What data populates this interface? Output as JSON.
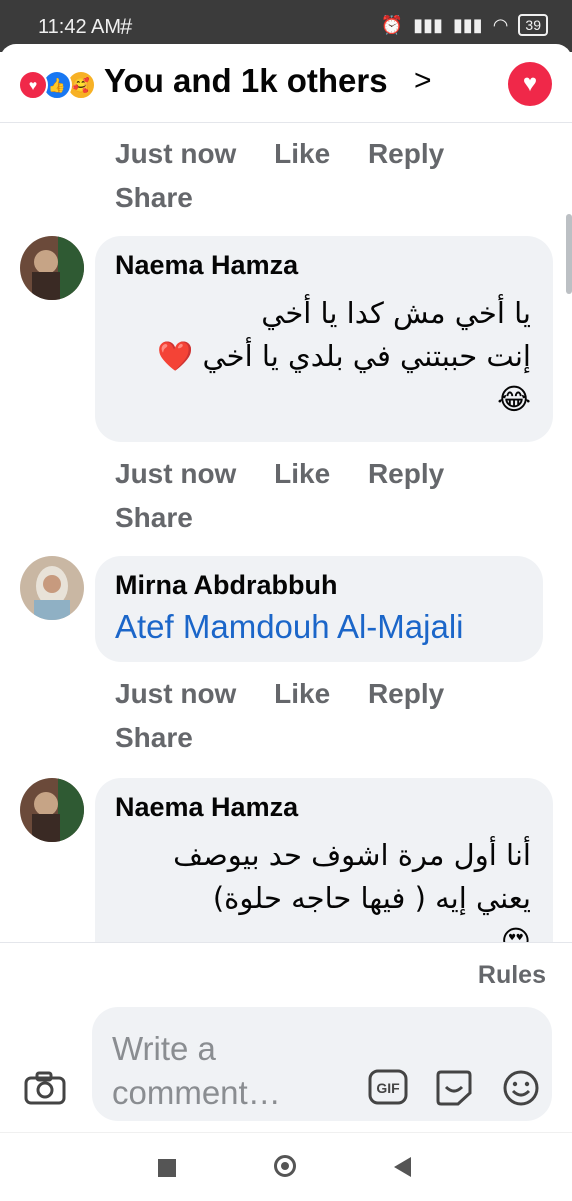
{
  "status_bar": {
    "time": "11:42 AM",
    "hash_icon": "#",
    "battery": "39"
  },
  "header": {
    "title": "You and 1k others",
    "reaction_icons": [
      "love-icon",
      "like-icon",
      "care-icon"
    ]
  },
  "comments": [
    {
      "type": "actions",
      "time": "Just now",
      "like": "Like",
      "reply": "Reply",
      "share": "Share"
    },
    {
      "type": "comment",
      "name": "Naema Hamza",
      "lines": [
        "يا أخي مش كدا يا أخي",
        "إنت حببتني في بلدي يا أخي ❤️",
        "😂"
      ]
    },
    {
      "type": "actions",
      "time": "Just now",
      "like": "Like",
      "reply": "Reply",
      "share": "Share"
    },
    {
      "type": "comment",
      "name": "Mirna Abdrabbuh",
      "link": "Atef Mamdouh Al-Majali"
    },
    {
      "type": "actions",
      "time": "Just now",
      "like": "Like",
      "reply": "Reply",
      "share": "Share"
    },
    {
      "type": "comment",
      "name": "Naema Hamza",
      "lines": [
        "أنا أول مرة اشوف حد بيوصف",
        "يعني إيه ( فيها حاجه حلوة)",
        "😍"
      ]
    }
  ],
  "footer": {
    "rules": "Rules",
    "composer_placeholder": "Write a comment…",
    "gif_label": "GIF"
  },
  "colors": {
    "accent": "#1b66c9",
    "love": "#f02849",
    "bubble": "#f0f2f5",
    "meta": "#65676b"
  }
}
